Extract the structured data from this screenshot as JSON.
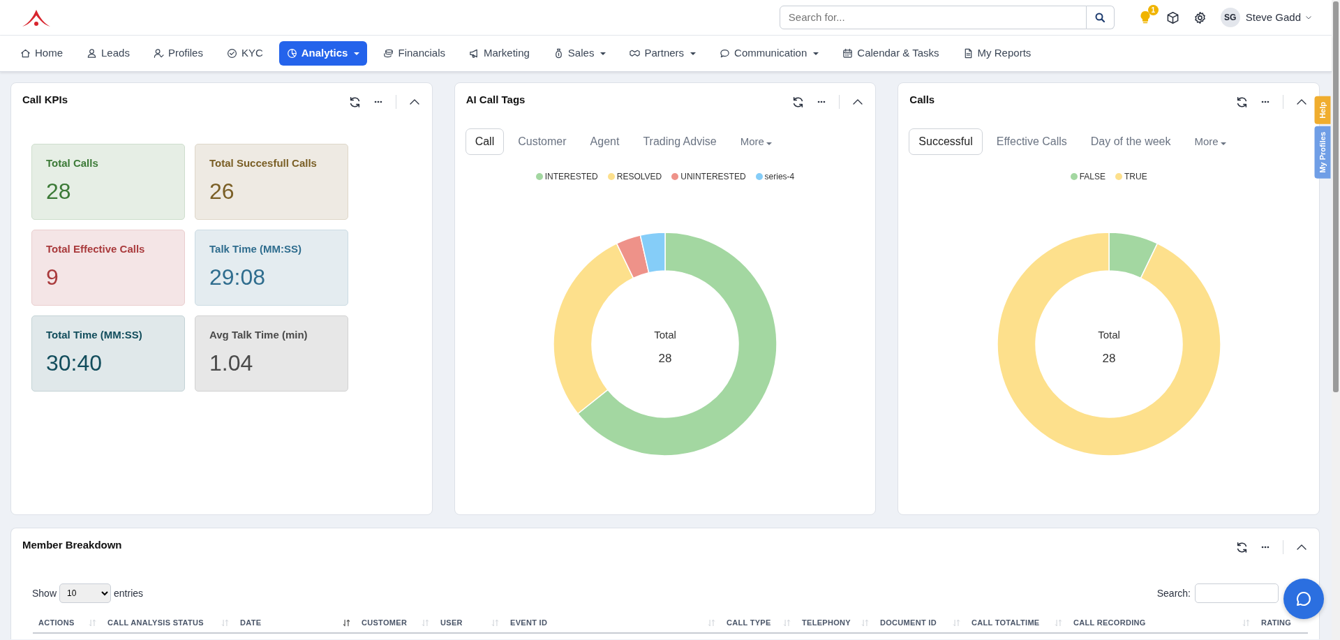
{
  "header": {
    "search": {
      "placeholder": "Search for..."
    },
    "notification_count": "1",
    "user": {
      "initials": "SG",
      "name": "Steve Gadd"
    }
  },
  "nav": [
    {
      "label": "Home",
      "selected": false,
      "has_menu": false
    },
    {
      "label": "Leads",
      "selected": false,
      "has_menu": false
    },
    {
      "label": "Profiles",
      "selected": false,
      "has_menu": false
    },
    {
      "label": "KYC",
      "selected": false,
      "has_menu": false
    },
    {
      "label": "Analytics",
      "selected": true,
      "has_menu": true
    },
    {
      "label": "Financials",
      "selected": false,
      "has_menu": false
    },
    {
      "label": "Marketing",
      "selected": false,
      "has_menu": false
    },
    {
      "label": "Sales",
      "selected": false,
      "has_menu": true
    },
    {
      "label": "Partners",
      "selected": false,
      "has_menu": true
    },
    {
      "label": "Communication",
      "selected": false,
      "has_menu": true
    },
    {
      "label": "Calendar & Tasks",
      "selected": false,
      "has_menu": false
    },
    {
      "label": "My Reports",
      "selected": false,
      "has_menu": false
    }
  ],
  "side_tabs": [
    {
      "label": "Help",
      "color": "#f0ad2e"
    },
    {
      "label": "My Profiles",
      "color": "#6f9ee6"
    }
  ],
  "widgets": [
    {
      "kind": "kpi",
      "title": "Call KPIs",
      "tiles": [
        {
          "label": "Total Calls",
          "value": "28",
          "color": "#3c7a37"
        },
        {
          "label": "Total Succesfull Calls",
          "value": "26",
          "color": "#7a5f26"
        },
        {
          "label": "Total Effective Calls",
          "value": "9",
          "color": "#a93a3c"
        },
        {
          "label": "Talk Time (MM:SS)",
          "value": "29:08",
          "color": "#2f6d8e"
        },
        {
          "label": "Total Time (MM:SS)",
          "value": "30:40",
          "color": "#124d5c"
        },
        {
          "label": "Avg Talk Time (min)",
          "value": "1.04",
          "color": "#4a4a4a"
        }
      ]
    },
    {
      "kind": "donut",
      "title": "AI Call Tags",
      "tabs": [
        {
          "label": "Call",
          "selected": true,
          "has_menu": false
        },
        {
          "label": "Customer",
          "selected": false,
          "has_menu": false
        },
        {
          "label": "Agent",
          "selected": false,
          "has_menu": false
        },
        {
          "label": "Trading Advise",
          "selected": false,
          "has_menu": false
        },
        {
          "label": "More",
          "selected": false,
          "has_menu": true
        }
      ],
      "legend": [
        {
          "label": "INTERESTED",
          "color": "#a3d7a1"
        },
        {
          "label": "RESOLVED",
          "color": "#fde08c"
        },
        {
          "label": "UNINTERESTED",
          "color": "#ee9289"
        },
        {
          "label": "series-4",
          "color": "#85cdf8"
        }
      ],
      "center_label": "Total",
      "center_value": "28",
      "chart_data": {
        "type": "donut",
        "values": [
          64.29,
          28.57,
          3.57,
          3.57
        ]
      }
    },
    {
      "kind": "donut",
      "title": "Calls",
      "tabs": [
        {
          "label": "Successful",
          "selected": true,
          "has_menu": false
        },
        {
          "label": "Effective Calls",
          "selected": false,
          "has_menu": false
        },
        {
          "label": "Day of the week",
          "selected": false,
          "has_menu": false
        },
        {
          "label": "More",
          "selected": false,
          "has_menu": true
        }
      ],
      "legend": [
        {
          "label": "FALSE",
          "color": "#a3d7a1"
        },
        {
          "label": "TRUE",
          "color": "#fde08c"
        }
      ],
      "center_label": "Total",
      "center_value": "28",
      "chart_data": {
        "type": "donut",
        "values": [
          7.14,
          92.86
        ]
      }
    }
  ],
  "breakdown": {
    "title": "Member Breakdown",
    "show_label": "Show",
    "page_size": "10",
    "entries_label": "entries",
    "search_label": "Search:",
    "columns": [
      {
        "label": "ACTIONS",
        "sorted": false
      },
      {
        "label": "CALL ANALYSIS STATUS",
        "sorted": false
      },
      {
        "label": "DATE",
        "sorted": true
      },
      {
        "label": "CUSTOMER",
        "sorted": false
      },
      {
        "label": "USER",
        "sorted": false
      },
      {
        "label": "EVENT ID",
        "sorted": false
      },
      {
        "label": "CALL TYPE",
        "sorted": false
      },
      {
        "label": "TELEPHONY",
        "sorted": false
      },
      {
        "label": "DOCUMENT ID",
        "sorted": false
      },
      {
        "label": "CALL TOTALTIME",
        "sorted": false
      },
      {
        "label": "CALL RECORDING",
        "sorted": false
      },
      {
        "label": "RATING"
      }
    ]
  }
}
